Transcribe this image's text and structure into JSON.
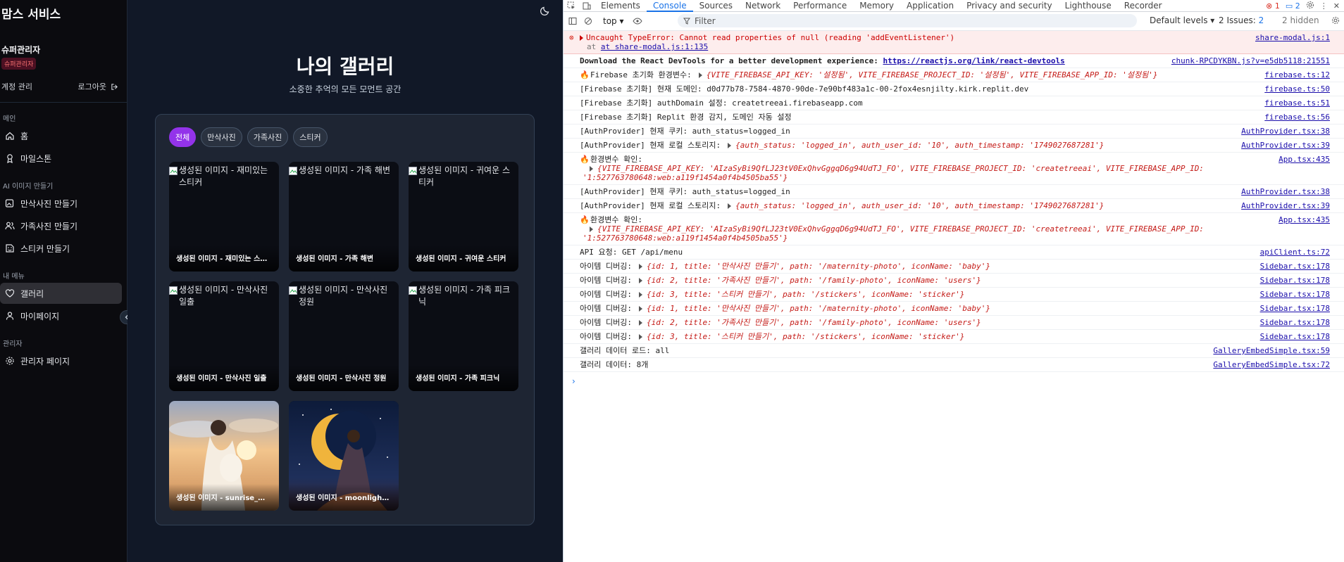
{
  "site": {
    "brand": "맘스 서비스",
    "user_name": "슈퍼관리자",
    "user_badge": "슈퍼관리자",
    "account_label": "계정 관리",
    "logout_label": "로그아웃",
    "sections": {
      "main": "메인",
      "ai": "AI 이미지 만들기",
      "my": "내 메뉴",
      "admin": "관리자"
    },
    "nav": {
      "home": "홈",
      "milestone": "마일스톤",
      "maternity": "만삭사진 만들기",
      "family": "가족사진 만들기",
      "sticker": "스티커 만들기",
      "gallery": "갤러리",
      "mypage": "마이페이지",
      "adminpage": "관리자 페이지"
    },
    "page_title": "나의 갤러리",
    "page_subtitle": "소중한 추억의 모든 모먼트 공간",
    "filters": [
      "전체",
      "만삭사진",
      "가족사진",
      "스티커"
    ],
    "gallery": [
      {
        "alt": "생성된 이미지 - 재미있는 스티커",
        "caption": "생성된 이미지 - 재미있는 스티커"
      },
      {
        "alt": "생성된 이미지 - 가족 해변",
        "caption": "생성된 이미지 - 가족 해변"
      },
      {
        "alt": "생성된 이미지 - 귀여운 스티커",
        "caption": "생성된 이미지 - 귀여운 스티커"
      },
      {
        "alt": "생성된 이미지 - 만삭사진 일출",
        "caption": "생성된 이미지 - 만삭사진 일출"
      },
      {
        "alt": "생성된 이미지 - 만삭사진 정원",
        "caption": "생성된 이미지 - 만삭사진 정원"
      },
      {
        "alt": "생성된 이미지 - 가족 피크닉",
        "caption": "생성된 이미지 - 가족 피크닉"
      },
      {
        "alt": "",
        "caption": "생성된 이미지 - sunrise_maternity"
      },
      {
        "alt": "",
        "caption": "생성된 이미지 - moonlight_maternity"
      }
    ]
  },
  "devtools": {
    "tabs": [
      "Elements",
      "Console",
      "Sources",
      "Network",
      "Performance",
      "Memory",
      "Application",
      "Privacy and security",
      "Lighthouse",
      "Recorder"
    ],
    "error_count": "1",
    "msg_count": "2",
    "context": "top",
    "filter_placeholder": "Filter",
    "levels": "Default levels",
    "issues_label": "2 Issues:",
    "issues_count": "2",
    "hidden": "2 hidden",
    "logs": [
      {
        "text": "Uncaught TypeError: Cannot read properties of null (reading 'addEventListener')",
        "sub": "at share-modal.js:1:135",
        "src": "share-modal.js:1"
      },
      {
        "text": "Download the React DevTools for a better development experience: ",
        "link": "https://reactjs.org/link/react-devtools",
        "src": "chunk-RPCDYKBN.js?v=e5db5118:21551"
      },
      {
        "text": "Firebase 초기화 환경변수:",
        "obj": "{VITE_FIREBASE_API_KEY: '설정됨', VITE_FIREBASE_PROJECT_ID: '설정됨', VITE_FIREBASE_APP_ID: '설정됨'}",
        "src": "firebase.ts:12"
      },
      {
        "text": "[Firebase 초기화] 현재 도메인: d0d77b78-7584-4870-90de-7e90bf483a1c-00-2fox4esnjilty.kirk.replit.dev",
        "src": "firebase.ts:50"
      },
      {
        "text": "[Firebase 초기화] authDomain 설정: createtreeai.firebaseapp.com",
        "src": "firebase.ts:51"
      },
      {
        "text": "[Firebase 초기화] Replit 환경 감지, 도메인 자동 설정",
        "src": "firebase.ts:56"
      },
      {
        "text": "[AuthProvider] 현재 쿠키: auth_status=logged_in",
        "src": "AuthProvider.tsx:38"
      },
      {
        "text": "[AuthProvider] 현재 로컬 스토리지:",
        "obj": "{auth_status: 'logged_in', auth_user_id: '10', auth_timestamp: '1749027687281'}",
        "src": "AuthProvider.tsx:39"
      },
      {
        "text": "환경변수 확인:",
        "obj": "{VITE_FIREBASE_API_KEY: 'AIzaSyBi9QfLJ23tV0ExQhvGggqD6g94UdTJ_FO', VITE_FIREBASE_PROJECT_ID: 'createtreeai', VITE_FIREBASE_APP_ID: '1:527763780648:web:a119f1454a0f4b4505ba55'}",
        "src": "App.tsx:435"
      },
      {
        "text": "[AuthProvider] 현재 쿠키: auth_status=logged_in",
        "src": "AuthProvider.tsx:38"
      },
      {
        "text": "[AuthProvider] 현재 로컬 스토리지:",
        "obj": "{auth_status: 'logged_in', auth_user_id: '10', auth_timestamp: '1749027687281'}",
        "src": "AuthProvider.tsx:39"
      },
      {
        "text": "환경변수 확인:",
        "obj": "{VITE_FIREBASE_API_KEY: 'AIzaSyBi9QfLJ23tV0ExQhvGggqD6g94UdTJ_FO', VITE_FIREBASE_PROJECT_ID: 'createtreeai', VITE_FIREBASE_APP_ID: '1:527763780648:web:a119f1454a0f4b4505ba55'}",
        "src": "App.tsx:435"
      },
      {
        "text": "API 요청: GET /api/menu",
        "src": "apiClient.ts:72"
      },
      {
        "text": "아이템 디버깅:",
        "obj": "{id: 1, title: '만삭사진 만들기', path: '/maternity-photo', iconName: 'baby'}",
        "src": "Sidebar.tsx:178"
      },
      {
        "text": "아이템 디버깅:",
        "obj": "{id: 2, title: '가족사진 만들기', path: '/family-photo', iconName: 'users'}",
        "src": "Sidebar.tsx:178"
      },
      {
        "text": "아이템 디버깅:",
        "obj": "{id: 3, title: '스티커 만들기', path: '/stickers', iconName: 'sticker'}",
        "src": "Sidebar.tsx:178"
      },
      {
        "text": "아이템 디버깅:",
        "obj": "{id: 1, title: '만삭사진 만들기', path: '/maternity-photo', iconName: 'baby'}",
        "src": "Sidebar.tsx:178"
      },
      {
        "text": "아이템 디버깅:",
        "obj": "{id: 2, title: '가족사진 만들기', path: '/family-photo', iconName: 'users'}",
        "src": "Sidebar.tsx:178"
      },
      {
        "text": "아이템 디버깅:",
        "obj": "{id: 3, title: '스티커 만들기', path: '/stickers', iconName: 'sticker'}",
        "src": "Sidebar.tsx:178"
      },
      {
        "text": "갤러리 데이터 로드: all",
        "src": "GalleryEmbedSimple.tsx:59"
      },
      {
        "text": "갤러리 데이터: 8개",
        "src": "GalleryEmbedSimple.tsx:72"
      }
    ],
    "prompt": "›"
  }
}
